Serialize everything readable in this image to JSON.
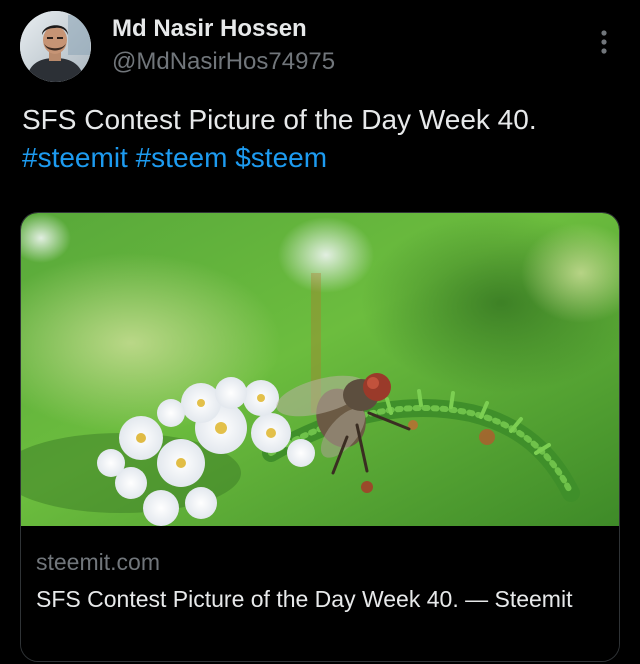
{
  "author": {
    "display_name": "Md Nasir Hossen",
    "handle": "@MdNasirHos74975"
  },
  "tweet": {
    "text": "SFS Contest Picture of the Day Week 40.",
    "hashtags": [
      "#steemit",
      "#steem",
      "$steem"
    ]
  },
  "link_card": {
    "domain": "steemit.com",
    "title": "SFS Contest Picture of the Day Week 40. — Steemit"
  },
  "icons": {
    "menu": "more-vertical-icon"
  },
  "colors": {
    "background": "#000000",
    "text": "#e7e9ea",
    "secondary_text": "#71767b",
    "link": "#1d9bf0",
    "border": "#2f3336"
  }
}
